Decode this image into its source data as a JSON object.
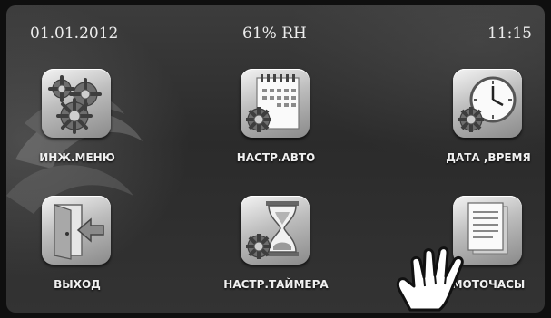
{
  "status": {
    "date": "01.01.2012",
    "humidity": "61% RH",
    "time": "11:15"
  },
  "menu": {
    "items": [
      {
        "label": "ИНЖ.МЕНЮ",
        "icon": "gears-icon"
      },
      {
        "label": "НАСТР.АВТО",
        "icon": "calendar-gear-icon"
      },
      {
        "label": "ДАТА ,ВРЕМЯ",
        "icon": "clock-gear-icon"
      },
      {
        "label": "ВЫХОД",
        "icon": "exit-door-icon"
      },
      {
        "label": "НАСТР.ТАЙМЕРА",
        "icon": "hourglass-gear-icon"
      },
      {
        "label": "МОТОЧАСЫ",
        "icon": "document-icon"
      }
    ]
  },
  "colors": {
    "background": "#333333",
    "text": "#ededed",
    "icon_face": "#bdbdbd"
  }
}
